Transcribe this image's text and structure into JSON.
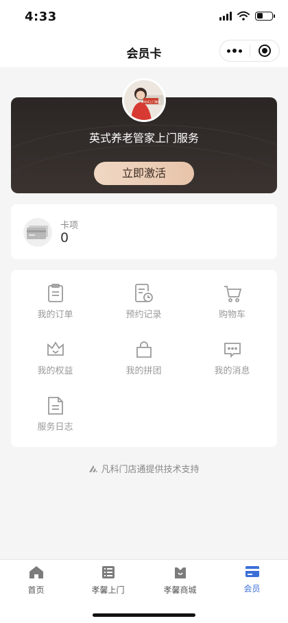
{
  "status": {
    "time": "4:33"
  },
  "nav": {
    "title": "会员卡"
  },
  "card": {
    "name": "英式养老管家上门服务",
    "activate_label": "立即激活",
    "avatar_text": "一站式上门服务",
    "bg_color": "#2b2624",
    "button_color": "#ecd0ba"
  },
  "kaxiang": {
    "label": "卡项",
    "value": "0"
  },
  "grid": {
    "items": [
      {
        "label": "我的订单",
        "icon": "order-icon"
      },
      {
        "label": "预约记录",
        "icon": "appointment-icon"
      },
      {
        "label": "购物车",
        "icon": "cart-icon"
      },
      {
        "label": "我的权益",
        "icon": "crown-icon"
      },
      {
        "label": "我的拼团",
        "icon": "bag-icon"
      },
      {
        "label": "我的消息",
        "icon": "message-icon"
      },
      {
        "label": "服务日志",
        "icon": "log-icon"
      }
    ]
  },
  "footer": {
    "support_text": "凡科门店通提供技术支持"
  },
  "tabs": [
    {
      "label": "首页",
      "icon": "home-icon"
    },
    {
      "label": "孝馨上门",
      "icon": "list-icon"
    },
    {
      "label": "孝馨商城",
      "icon": "shop-icon"
    },
    {
      "label": "会员",
      "icon": "member-card-icon",
      "active": true
    }
  ],
  "colors": {
    "accent": "#3a6fd8",
    "icon_gray": "#9a9a9a"
  }
}
